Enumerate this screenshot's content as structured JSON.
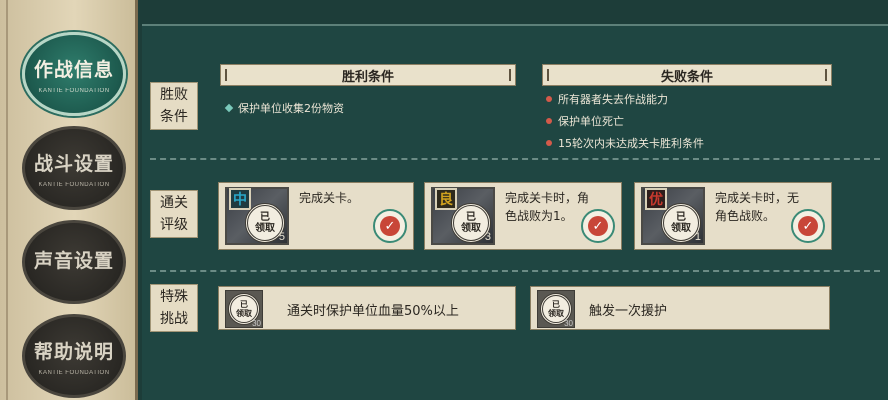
{
  "sidebar": {
    "items": [
      {
        "label": "作战信息",
        "sub": "KANTIE FOUNDATION",
        "active": true
      },
      {
        "label": "战斗设置",
        "sub": "KANTIE FOUNDATION",
        "active": false
      },
      {
        "label": "声音设置",
        "sub": "",
        "active": false
      },
      {
        "label": "帮助说明",
        "sub": "KANTIE FOUNDATION",
        "active": false
      }
    ]
  },
  "conditions": {
    "label_line1": "胜败",
    "label_line2": "条件",
    "win_header": "胜利条件",
    "lose_header": "失败条件",
    "win_items": [
      "保护单位收集2份物资"
    ],
    "lose_items": [
      "所有器者失去作战能力",
      "保护单位死亡",
      "15轮次内未达成关卡胜利条件"
    ]
  },
  "rating": {
    "label_line1": "通关",
    "label_line2": "评级",
    "cards": [
      {
        "grade": "中",
        "grade_color": "#2aa7c9",
        "seal_line1": "已",
        "seal_line2": "领取",
        "count": "5",
        "text": "完成关卡。"
      },
      {
        "grade": "良",
        "grade_color": "#d1a21e",
        "seal_line1": "已",
        "seal_line2": "领取",
        "count": "3",
        "text": "完成关卡时，角色战败为1。"
      },
      {
        "grade": "优",
        "grade_color": "#c83a2e",
        "seal_line1": "已",
        "seal_line2": "领取",
        "count": "1",
        "text": "完成关卡时，无角色战败。"
      }
    ]
  },
  "special": {
    "label_line1": "特殊",
    "label_line2": "挑战",
    "items": [
      {
        "seal_line1": "已",
        "seal_line2": "领取",
        "count": "30",
        "text": "通关时保护单位血量50%以上"
      },
      {
        "seal_line1": "已",
        "seal_line2": "领取",
        "count": "30",
        "text": "触发一次援护"
      }
    ]
  },
  "colors": {
    "panel": "#1f4642",
    "accent": "#2f7d6c",
    "parchment": "#e6dec9",
    "win_bullet": "#7ac9bb",
    "lose_bullet": "#d45a4a"
  }
}
